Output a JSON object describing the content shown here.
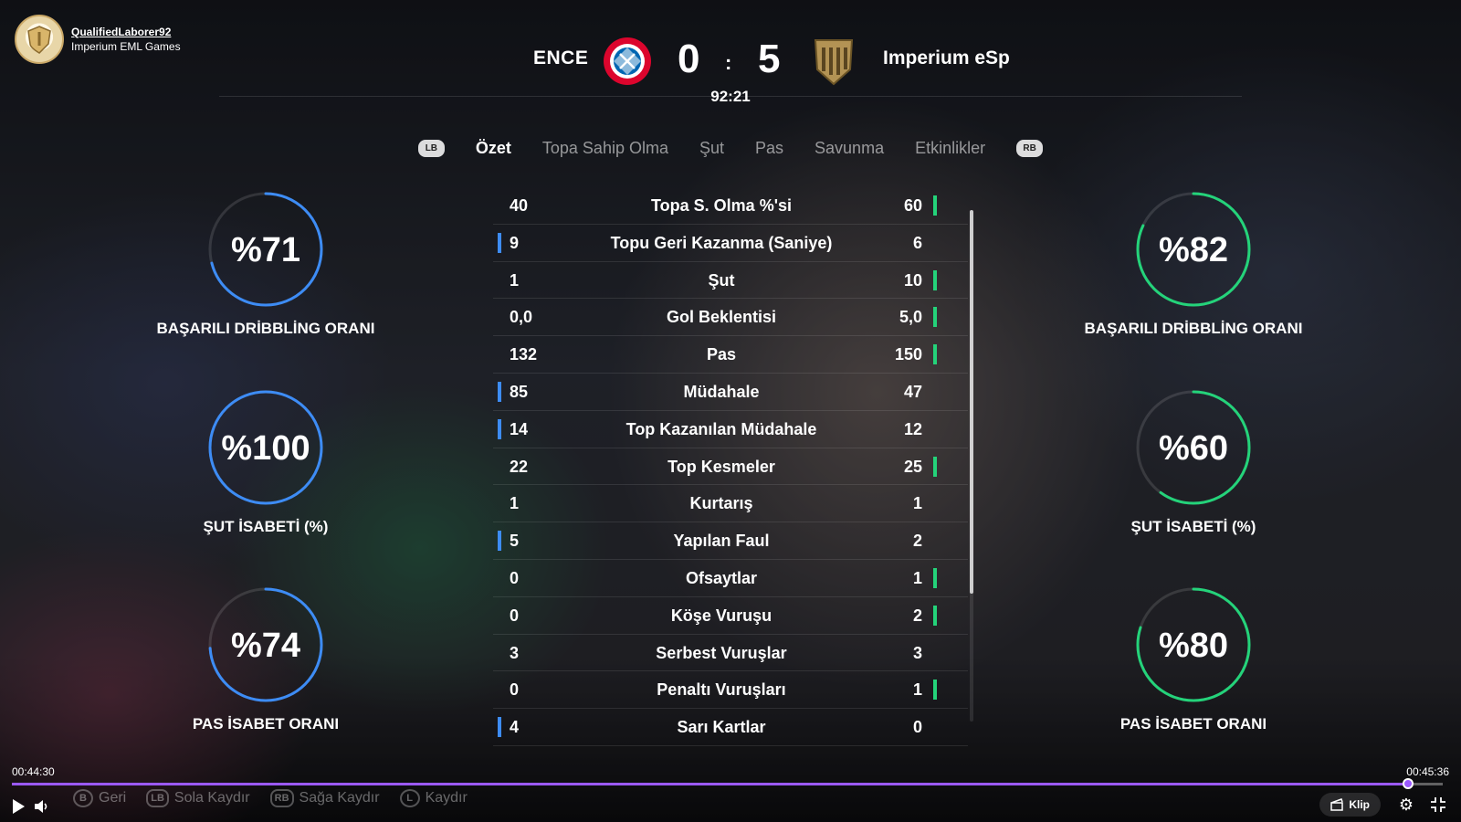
{
  "channel": {
    "name": "QualifiedLaborer92",
    "subtitle": "Imperium EML Games"
  },
  "match": {
    "home_team": "ENCE",
    "away_team": "Imperium eSp",
    "home_score": "0",
    "separator": ":",
    "away_score": "5",
    "clock": "92:21"
  },
  "tabs": {
    "left_bumper": "LB",
    "right_bumper": "RB",
    "items": [
      "Özet",
      "Topa Sahip Olma",
      "Şut",
      "Pas",
      "Savunma",
      "Etkinlikler"
    ],
    "active_index": 0
  },
  "colors": {
    "home": "#3d8cf5",
    "away": "#24d37a",
    "progress": "#9b59ff"
  },
  "left_gauges": [
    {
      "value": "%71",
      "percent": 71,
      "label": "BAŞARILI DRİBBLİNG ORANI"
    },
    {
      "value": "%100",
      "percent": 100,
      "label": "ŞUT İSABETİ (%)"
    },
    {
      "value": "%74",
      "percent": 74,
      "label": "PAS İSABET ORANI"
    }
  ],
  "right_gauges": [
    {
      "value": "%82",
      "percent": 82,
      "label": "BAŞARILI DRİBBLİNG ORANI"
    },
    {
      "value": "%60",
      "percent": 60,
      "label": "ŞUT İSABETİ (%)"
    },
    {
      "value": "%80",
      "percent": 80,
      "label": "PAS İSABET ORANI"
    }
  ],
  "stats": [
    {
      "name": "Topa S. Olma %'si",
      "home": "40",
      "away": "60",
      "lead": "away"
    },
    {
      "name": "Topu Geri Kazanma (Saniye)",
      "home": "9",
      "away": "6",
      "lead": "home"
    },
    {
      "name": "Şut",
      "home": "1",
      "away": "10",
      "lead": "away"
    },
    {
      "name": "Gol Beklentisi",
      "home": "0,0",
      "away": "5,0",
      "lead": "away"
    },
    {
      "name": "Pas",
      "home": "132",
      "away": "150",
      "lead": "away"
    },
    {
      "name": "Müdahale",
      "home": "85",
      "away": "47",
      "lead": "home"
    },
    {
      "name": "Top Kazanılan Müdahale",
      "home": "14",
      "away": "12",
      "lead": "home"
    },
    {
      "name": "Top Kesmeler",
      "home": "22",
      "away": "25",
      "lead": "away"
    },
    {
      "name": "Kurtarış",
      "home": "1",
      "away": "1",
      "lead": "none"
    },
    {
      "name": "Yapılan Faul",
      "home": "5",
      "away": "2",
      "lead": "home"
    },
    {
      "name": "Ofsaytlar",
      "home": "0",
      "away": "1",
      "lead": "away"
    },
    {
      "name": "Köşe Vuruşu",
      "home": "0",
      "away": "2",
      "lead": "away"
    },
    {
      "name": "Serbest Vuruşlar",
      "home": "3",
      "away": "3",
      "lead": "none"
    },
    {
      "name": "Penaltı Vuruşları",
      "home": "0",
      "away": "1",
      "lead": "away"
    },
    {
      "name": "Sarı Kartlar",
      "home": "4",
      "away": "0",
      "lead": "home"
    }
  ],
  "player": {
    "current_time": "00:44:30",
    "total_time": "00:45:36",
    "progress_fraction": 0.976,
    "hints": [
      {
        "key": "B",
        "label": "Geri"
      },
      {
        "key": "LB",
        "label": "Sola Kaydır"
      },
      {
        "key": "RB",
        "label": "Sağa Kaydır"
      },
      {
        "key": "L",
        "label": "Kaydır"
      }
    ],
    "clip_label": "Klip"
  }
}
